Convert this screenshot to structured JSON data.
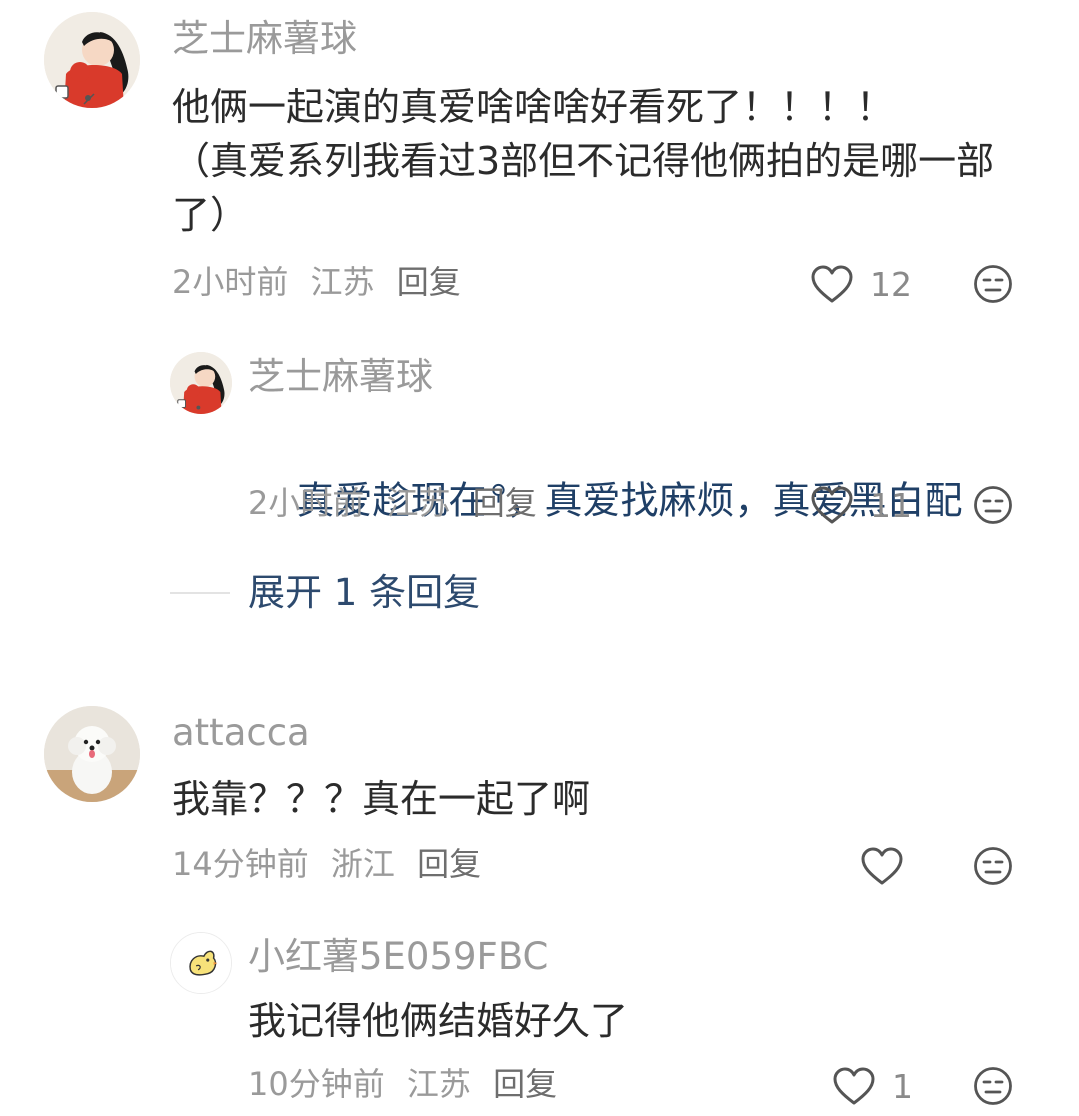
{
  "comments": [
    {
      "username": "芝士麻薯球",
      "text": "他俩一起演的真爱啥啥啥好看死了！！！！\n（真爱系列我看过3部但不记得他俩拍的是哪一部了）",
      "time": "2小时前",
      "location": "江苏",
      "reply_label": "回复",
      "likes": "12",
      "replies": [
        {
          "username": "芝士麻薯球",
          "text_link": "真爱趁现在",
          "text_rest": "，真爱找麻烦，真爱黑白配",
          "time": "2小时前",
          "location": "江苏",
          "reply_label": "回复",
          "likes": "11"
        }
      ],
      "expand_label": "展开 1 条回复"
    },
    {
      "username": "attacca",
      "text": "我靠？？？真在一起了啊",
      "time": "14分钟前",
      "location": "浙江",
      "reply_label": "回复",
      "likes": "",
      "replies": [
        {
          "username": "小红薯5E059FBC",
          "text": "我记得他俩结婚好久了",
          "time": "10分钟前",
          "location": "江苏",
          "reply_label": "回复",
          "likes": "1"
        }
      ]
    }
  ],
  "icons": {
    "like": "heart-outline-icon",
    "dislike": "neutral-face-icon",
    "search": "search-icon"
  },
  "colors": {
    "link": "#1f3f66",
    "meta": "#9a9a9a",
    "text": "#2b2b2b"
  }
}
